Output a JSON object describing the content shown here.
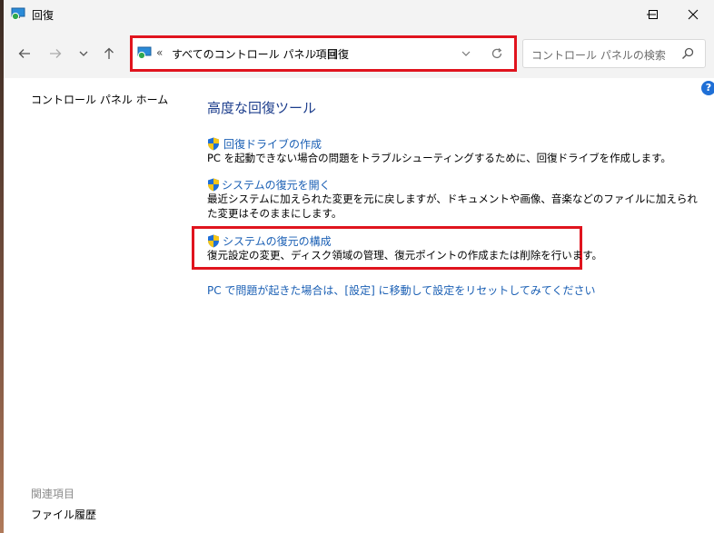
{
  "window": {
    "title": "回復"
  },
  "address_bar": {
    "overflow": "«",
    "crumbs": [
      "すべてのコントロール パネル項目",
      "回復"
    ],
    "separator": "›"
  },
  "search": {
    "placeholder": "コントロール パネルの検索"
  },
  "sidebar": {
    "home_link": "コントロール パネル ホーム",
    "related_title": "関連項目",
    "related_links": [
      "ファイル履歴"
    ]
  },
  "main": {
    "heading": "高度な回復ツール",
    "items": [
      {
        "link": "回復ドライブの作成",
        "description": "PC を起動できない場合の問題をトラブルシューティングするために、回復ドライブを作成します。",
        "icon": "uac-shield-icon"
      },
      {
        "link": "システムの復元を開く",
        "description": "最近システムに加えられた変更を元に戻しますが、ドキュメントや画像、音楽などのファイルに加えられた変更はそのままにします。",
        "icon": "uac-shield-icon"
      },
      {
        "link": "システムの復元の構成",
        "description": "復元設定の変更、ディスク領域の管理、復元ポイントの作成または削除を行います。",
        "icon": "uac-shield-icon"
      }
    ],
    "reset_link": "PC で問題が起きた場合は、[設定] に移動して設定をリセットしてみてください"
  },
  "colors": {
    "link": "#1a5fb4",
    "heading": "#1c3d8c",
    "highlight": "#e0141e"
  }
}
